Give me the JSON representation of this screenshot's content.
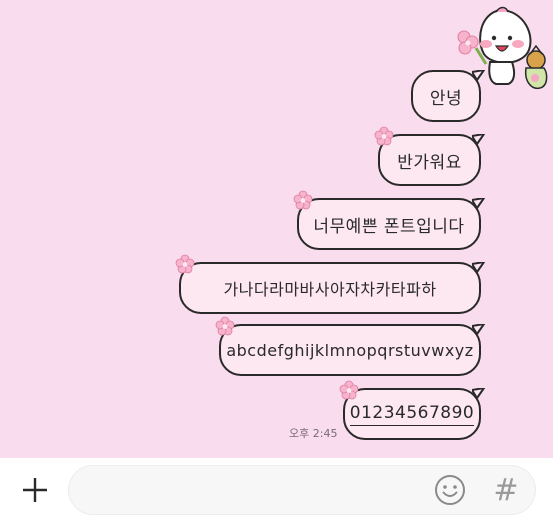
{
  "chat": {
    "messages": [
      {
        "text": "안녕"
      },
      {
        "text": "반가워요"
      },
      {
        "text": "너무예쁜 폰트입니다"
      },
      {
        "text": "가나다라마바사아자차카타파하"
      },
      {
        "text": "abcdefghijklmnopqrstuvwxyz"
      },
      {
        "text": "01234567890"
      }
    ],
    "last_time": "오후 2:45"
  },
  "input_bar": {
    "placeholder": "",
    "hash_label": "#"
  },
  "colors": {
    "chat_background": "#f9dced",
    "bubble_fill": "#fde8f1",
    "bubble_border": "#2a2a2a",
    "flower": "#f4a6c4"
  }
}
